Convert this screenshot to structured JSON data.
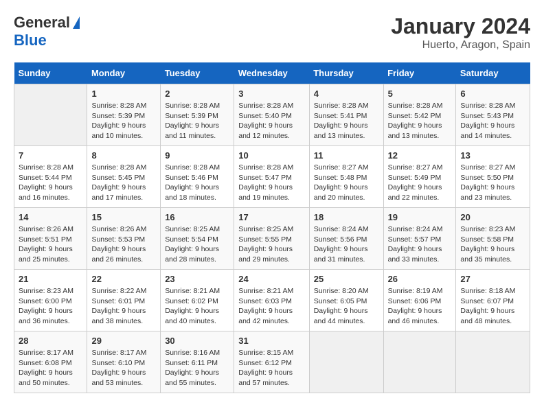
{
  "header": {
    "logo_general": "General",
    "logo_blue": "Blue",
    "title": "January 2024",
    "subtitle": "Huerto, Aragon, Spain"
  },
  "weekdays": [
    "Sunday",
    "Monday",
    "Tuesday",
    "Wednesday",
    "Thursday",
    "Friday",
    "Saturday"
  ],
  "weeks": [
    [
      {
        "day": "",
        "info": ""
      },
      {
        "day": "1",
        "info": "Sunrise: 8:28 AM\nSunset: 5:39 PM\nDaylight: 9 hours\nand 10 minutes."
      },
      {
        "day": "2",
        "info": "Sunrise: 8:28 AM\nSunset: 5:39 PM\nDaylight: 9 hours\nand 11 minutes."
      },
      {
        "day": "3",
        "info": "Sunrise: 8:28 AM\nSunset: 5:40 PM\nDaylight: 9 hours\nand 12 minutes."
      },
      {
        "day": "4",
        "info": "Sunrise: 8:28 AM\nSunset: 5:41 PM\nDaylight: 9 hours\nand 13 minutes."
      },
      {
        "day": "5",
        "info": "Sunrise: 8:28 AM\nSunset: 5:42 PM\nDaylight: 9 hours\nand 13 minutes."
      },
      {
        "day": "6",
        "info": "Sunrise: 8:28 AM\nSunset: 5:43 PM\nDaylight: 9 hours\nand 14 minutes."
      }
    ],
    [
      {
        "day": "7",
        "info": "Sunrise: 8:28 AM\nSunset: 5:44 PM\nDaylight: 9 hours\nand 16 minutes."
      },
      {
        "day": "8",
        "info": "Sunrise: 8:28 AM\nSunset: 5:45 PM\nDaylight: 9 hours\nand 17 minutes."
      },
      {
        "day": "9",
        "info": "Sunrise: 8:28 AM\nSunset: 5:46 PM\nDaylight: 9 hours\nand 18 minutes."
      },
      {
        "day": "10",
        "info": "Sunrise: 8:28 AM\nSunset: 5:47 PM\nDaylight: 9 hours\nand 19 minutes."
      },
      {
        "day": "11",
        "info": "Sunrise: 8:27 AM\nSunset: 5:48 PM\nDaylight: 9 hours\nand 20 minutes."
      },
      {
        "day": "12",
        "info": "Sunrise: 8:27 AM\nSunset: 5:49 PM\nDaylight: 9 hours\nand 22 minutes."
      },
      {
        "day": "13",
        "info": "Sunrise: 8:27 AM\nSunset: 5:50 PM\nDaylight: 9 hours\nand 23 minutes."
      }
    ],
    [
      {
        "day": "14",
        "info": "Sunrise: 8:26 AM\nSunset: 5:51 PM\nDaylight: 9 hours\nand 25 minutes."
      },
      {
        "day": "15",
        "info": "Sunrise: 8:26 AM\nSunset: 5:53 PM\nDaylight: 9 hours\nand 26 minutes."
      },
      {
        "day": "16",
        "info": "Sunrise: 8:25 AM\nSunset: 5:54 PM\nDaylight: 9 hours\nand 28 minutes."
      },
      {
        "day": "17",
        "info": "Sunrise: 8:25 AM\nSunset: 5:55 PM\nDaylight: 9 hours\nand 29 minutes."
      },
      {
        "day": "18",
        "info": "Sunrise: 8:24 AM\nSunset: 5:56 PM\nDaylight: 9 hours\nand 31 minutes."
      },
      {
        "day": "19",
        "info": "Sunrise: 8:24 AM\nSunset: 5:57 PM\nDaylight: 9 hours\nand 33 minutes."
      },
      {
        "day": "20",
        "info": "Sunrise: 8:23 AM\nSunset: 5:58 PM\nDaylight: 9 hours\nand 35 minutes."
      }
    ],
    [
      {
        "day": "21",
        "info": "Sunrise: 8:23 AM\nSunset: 6:00 PM\nDaylight: 9 hours\nand 36 minutes."
      },
      {
        "day": "22",
        "info": "Sunrise: 8:22 AM\nSunset: 6:01 PM\nDaylight: 9 hours\nand 38 minutes."
      },
      {
        "day": "23",
        "info": "Sunrise: 8:21 AM\nSunset: 6:02 PM\nDaylight: 9 hours\nand 40 minutes."
      },
      {
        "day": "24",
        "info": "Sunrise: 8:21 AM\nSunset: 6:03 PM\nDaylight: 9 hours\nand 42 minutes."
      },
      {
        "day": "25",
        "info": "Sunrise: 8:20 AM\nSunset: 6:05 PM\nDaylight: 9 hours\nand 44 minutes."
      },
      {
        "day": "26",
        "info": "Sunrise: 8:19 AM\nSunset: 6:06 PM\nDaylight: 9 hours\nand 46 minutes."
      },
      {
        "day": "27",
        "info": "Sunrise: 8:18 AM\nSunset: 6:07 PM\nDaylight: 9 hours\nand 48 minutes."
      }
    ],
    [
      {
        "day": "28",
        "info": "Sunrise: 8:17 AM\nSunset: 6:08 PM\nDaylight: 9 hours\nand 50 minutes."
      },
      {
        "day": "29",
        "info": "Sunrise: 8:17 AM\nSunset: 6:10 PM\nDaylight: 9 hours\nand 53 minutes."
      },
      {
        "day": "30",
        "info": "Sunrise: 8:16 AM\nSunset: 6:11 PM\nDaylight: 9 hours\nand 55 minutes."
      },
      {
        "day": "31",
        "info": "Sunrise: 8:15 AM\nSunset: 6:12 PM\nDaylight: 9 hours\nand 57 minutes."
      },
      {
        "day": "",
        "info": ""
      },
      {
        "day": "",
        "info": ""
      },
      {
        "day": "",
        "info": ""
      }
    ]
  ]
}
